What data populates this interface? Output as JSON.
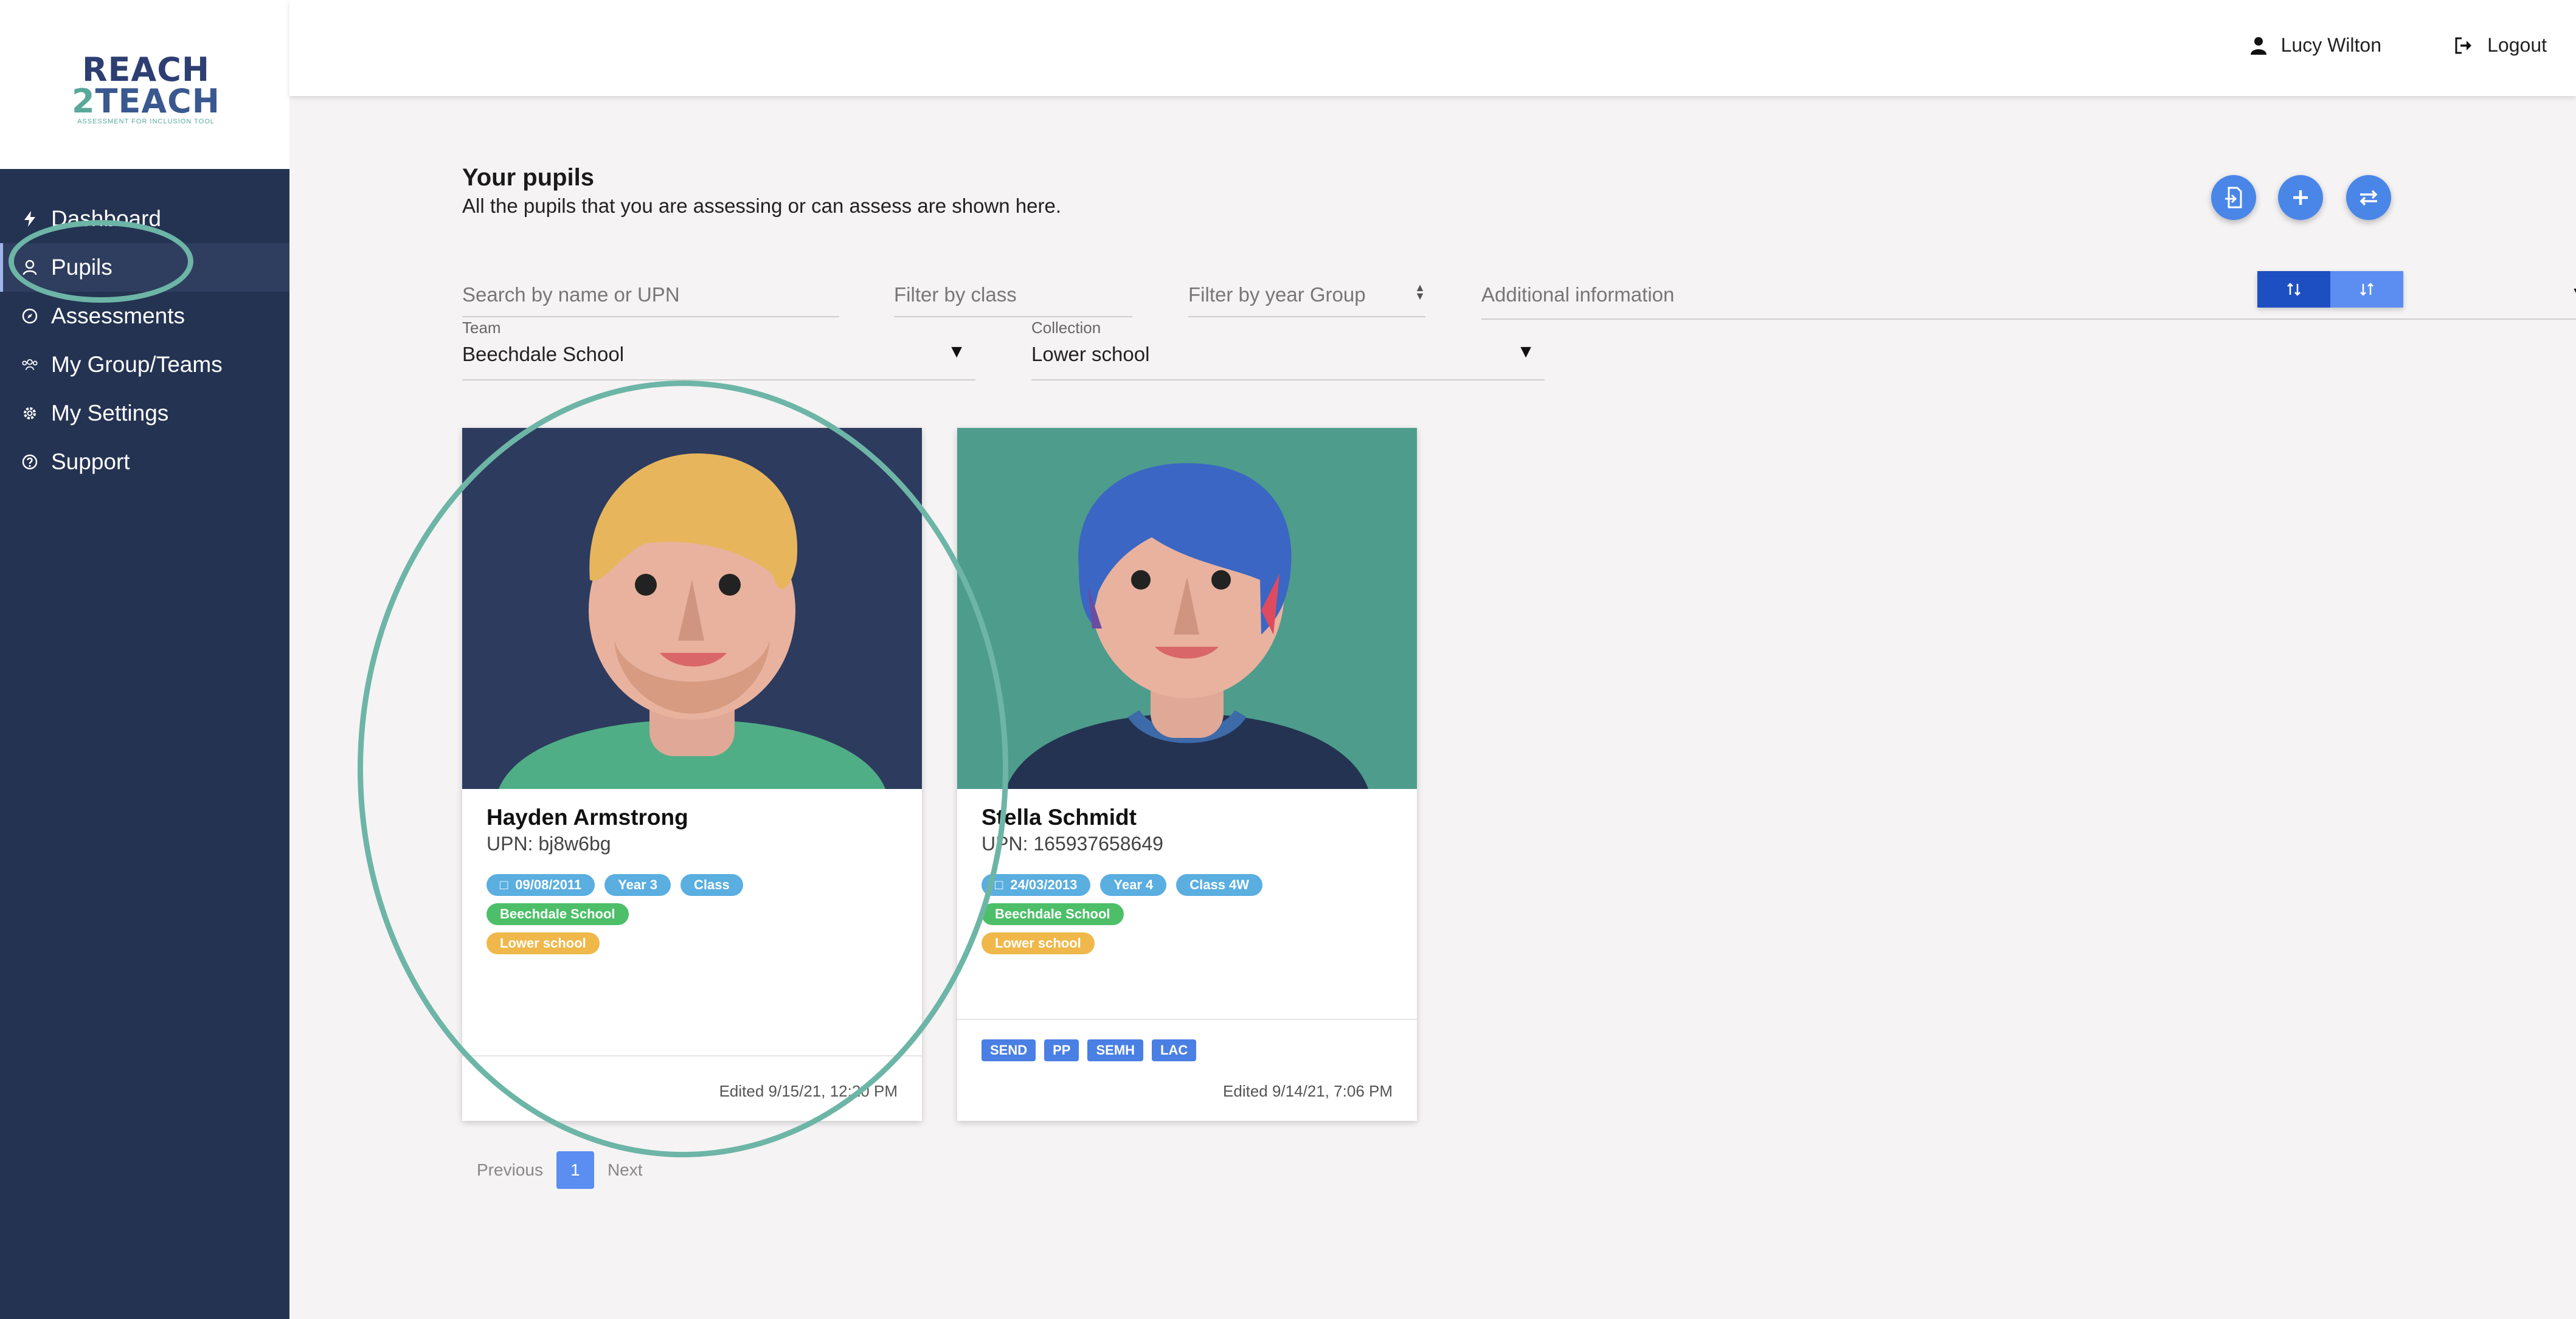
{
  "brand": {
    "line1": "REACH",
    "line2_digit": "2",
    "line2_text": "TEACH",
    "tagline": "ASSESSMENT FOR INCLUSION TOOL"
  },
  "sidebar": {
    "items": [
      {
        "label": "Dashboard",
        "icon": "bolt-icon"
      },
      {
        "label": "Pupils",
        "icon": "user-icon"
      },
      {
        "label": "Assessments",
        "icon": "compass-icon"
      },
      {
        "label": "My Group/Teams",
        "icon": "group-icon"
      },
      {
        "label": "My Settings",
        "icon": "gear-icon"
      },
      {
        "label": "Support",
        "icon": "help-icon"
      }
    ],
    "active": "Pupils"
  },
  "header": {
    "user_name": "Lucy Wilton",
    "logout_label": "Logout"
  },
  "main": {
    "title": "Your pupils",
    "subtitle": "All the pupils that you are assessing or can assess are shown here."
  },
  "filters": {
    "search_placeholder": "Search by name or UPN",
    "class_placeholder": "Filter by class",
    "year_placeholder": "Filter by year Group",
    "additional_label": "Additional information",
    "team_label": "Team",
    "team_value": "Beechdale School",
    "collection_label": "Collection",
    "collection_value": "Lower school"
  },
  "pupils": [
    {
      "name": "Hayden Armstrong",
      "upn": "UPN: bj8w6bg",
      "dob": "09/08/2011",
      "year": "Year 3",
      "class": "Class",
      "school": "Beechdale School",
      "collection": "Lower school",
      "tags": [],
      "edited": "Edited 9/15/21, 12:20 PM"
    },
    {
      "name": "Stella Schmidt",
      "upn": "UPN: 165937658649",
      "dob": "24/03/2013",
      "year": "Year 4",
      "class": "Class 4W",
      "school": "Beechdale School",
      "collection": "Lower school",
      "tags": [
        "SEND",
        "PP",
        "SEMH",
        "LAC"
      ],
      "edited": "Edited 9/14/21, 7:06 PM"
    }
  ],
  "pagination": {
    "previous": "Previous",
    "current": "1",
    "next": "Next"
  },
  "colors": {
    "sidebar": "#243352",
    "accent": "#4a86e8",
    "highlight_ring": "#6db5a6"
  }
}
